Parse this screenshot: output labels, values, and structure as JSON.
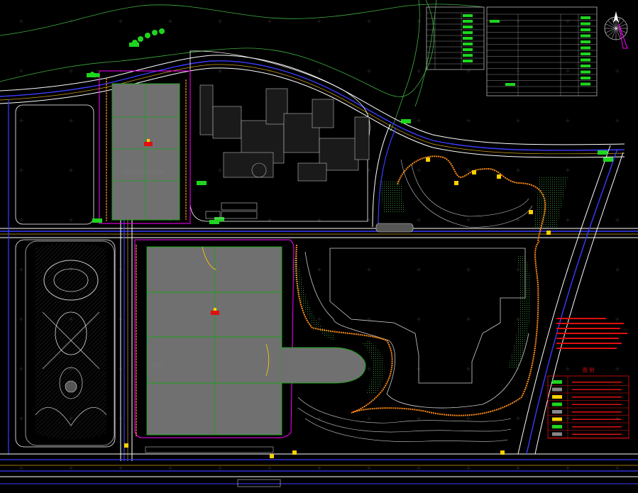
{
  "legend": {
    "title": "图 例"
  },
  "colors": {
    "background": "#000000",
    "road": "#3b3bff",
    "road_edge": "#ffffff",
    "field_fill": "#707070",
    "field_grid": "#1aa31a",
    "boundary": "#ff00ff",
    "orange_path": "#ff8c1a",
    "terrain": "#4fbf4f",
    "legend_red": "#e01010",
    "marker_green": "#1fd51f",
    "gold": "#d4a017"
  },
  "icons": [
    "north-arrow-icon",
    "compass-rose-icon"
  ]
}
